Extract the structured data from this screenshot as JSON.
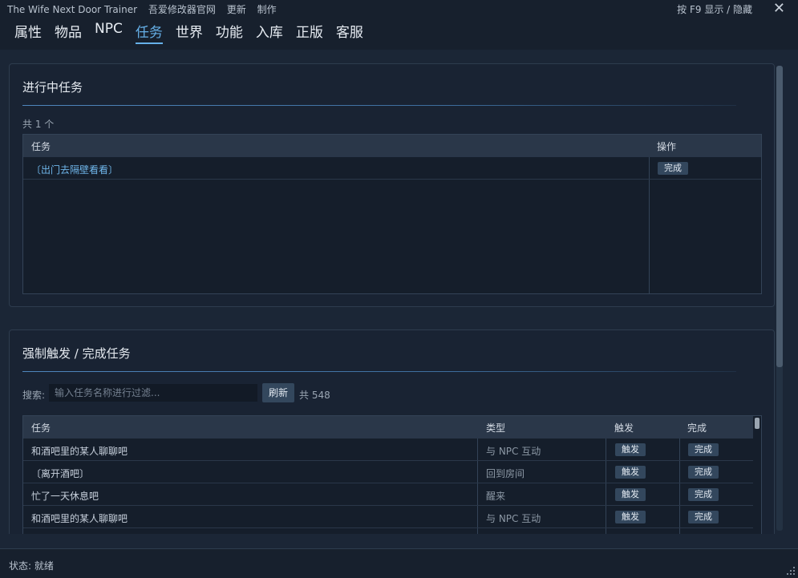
{
  "window": {
    "title": "The Wife Next Door Trainer",
    "menu": [
      "吾爱修改器官网",
      "更新",
      "制作"
    ],
    "hint": "按 F9 显示 / 隐藏",
    "close_glyph": "✕"
  },
  "tabs": [
    "属性",
    "物品",
    "NPC",
    "任务",
    "世界",
    "功能",
    "入库",
    "正版",
    "客服"
  ],
  "active_tab": "任务",
  "ongoing": {
    "title": "进行中任务",
    "count": "共 1 个",
    "headers": {
      "task": "任务",
      "action": "操作"
    },
    "rows": [
      {
        "task": "〔出门去隔壁看看〕",
        "action": "完成"
      }
    ]
  },
  "force": {
    "title": "强制触发 / 完成任务",
    "search_label": "搜索:",
    "search_placeholder": "输入任务名称进行过滤...",
    "refresh_label": "刷新",
    "total": "共 548",
    "headers": {
      "task": "任务",
      "type": "类型",
      "trigger": "触发",
      "complete": "完成"
    },
    "rows": [
      {
        "task": "和酒吧里的某人聊聊吧",
        "type": "与 NPC 互动",
        "trigger": "触发",
        "complete": "完成"
      },
      {
        "task": "〔离开酒吧〕",
        "type": "回到房间",
        "trigger": "触发",
        "complete": "完成"
      },
      {
        "task": "忙了一天休息吧",
        "type": "醒来",
        "trigger": "触发",
        "complete": "完成"
      },
      {
        "task": "和酒吧里的某人聊聊吧",
        "type": "与 NPC 互动",
        "trigger": "触发",
        "complete": "完成"
      }
    ]
  },
  "status": {
    "text": "状态: 就绪"
  }
}
